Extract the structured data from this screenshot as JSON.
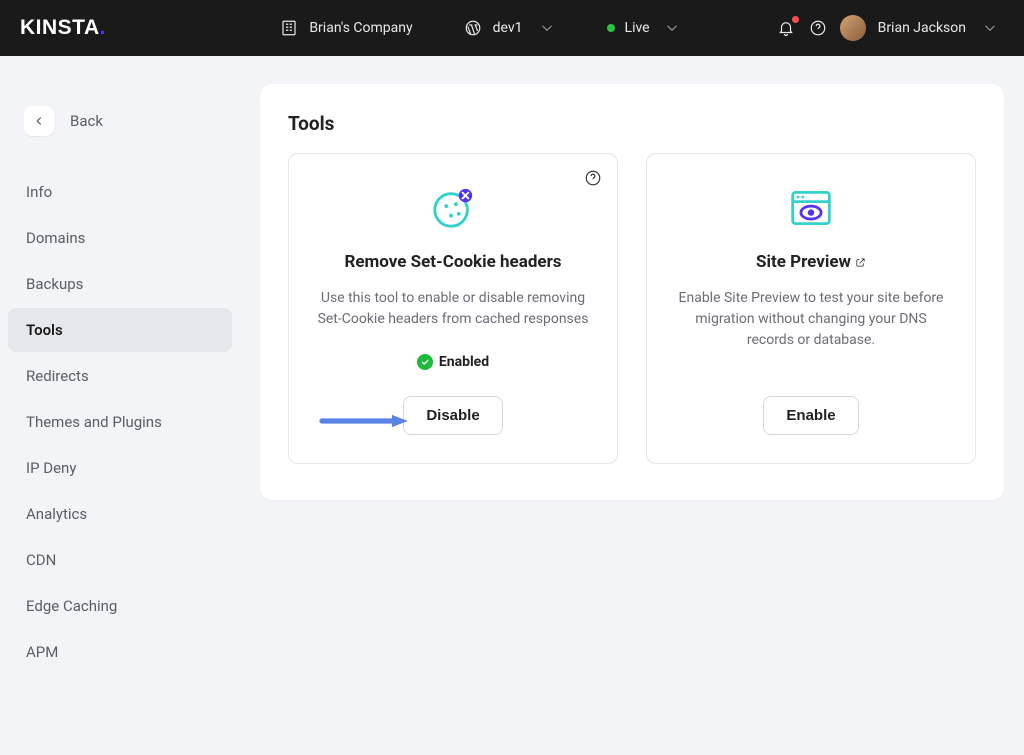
{
  "header": {
    "brand": "KINSTA",
    "company": "Brian's Company",
    "site": "dev1",
    "environment": "Live",
    "user": "Brian Jackson"
  },
  "sidebar": {
    "back_label": "Back",
    "items": [
      {
        "label": "Info"
      },
      {
        "label": "Domains"
      },
      {
        "label": "Backups"
      },
      {
        "label": "Tools",
        "active": true
      },
      {
        "label": "Redirects"
      },
      {
        "label": "Themes and Plugins"
      },
      {
        "label": "IP Deny"
      },
      {
        "label": "Analytics"
      },
      {
        "label": "CDN"
      },
      {
        "label": "Edge Caching"
      },
      {
        "label": "APM"
      }
    ]
  },
  "main": {
    "title": "Tools",
    "cards": [
      {
        "title": "Remove Set-Cookie headers",
        "desc": "Use this tool to enable or disable removing Set-Cookie headers from cached responses",
        "status": "Enabled",
        "button": "Disable",
        "has_help": true,
        "arrow": true
      },
      {
        "title": "Site Preview",
        "desc": "Enable Site Preview to test your site before migration without changing your DNS records or database.",
        "button": "Enable",
        "has_external": true
      }
    ]
  }
}
